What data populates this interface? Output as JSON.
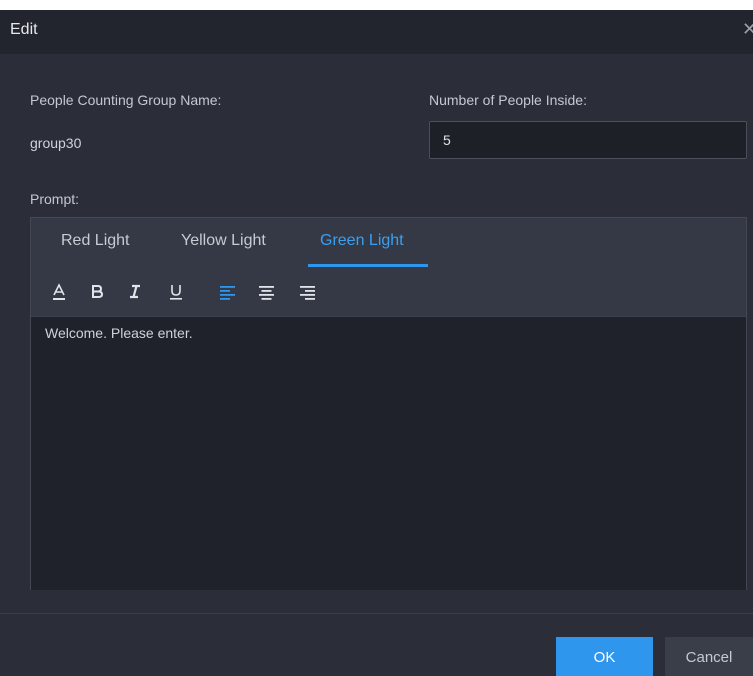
{
  "dialog": {
    "title": "Edit",
    "close_glyph": "✕"
  },
  "form": {
    "group_name_label": "People Counting Group Name:",
    "group_name_value": "group30",
    "people_inside_label": "Number of People Inside:",
    "people_inside_value": "5",
    "prompt_label": "Prompt:"
  },
  "prompt": {
    "tabs": [
      {
        "label": "Red Light",
        "active": false
      },
      {
        "label": "Yellow Light",
        "active": false
      },
      {
        "label": "Green Light",
        "active": true
      }
    ],
    "toolbar": {
      "icons": [
        "font-color-icon",
        "bold-icon",
        "italic-icon",
        "underline-icon",
        "align-left-icon",
        "align-center-icon",
        "align-right-icon"
      ],
      "active": "align-left-icon"
    },
    "editor_text": "Welcome. Please enter."
  },
  "footer": {
    "ok_label": "OK",
    "cancel_label": "Cancel"
  },
  "colors": {
    "accent": "#2f96ee",
    "dialog_bg": "#2b2e38",
    "header_bg": "#23252e",
    "editor_bg": "#1f222b"
  }
}
